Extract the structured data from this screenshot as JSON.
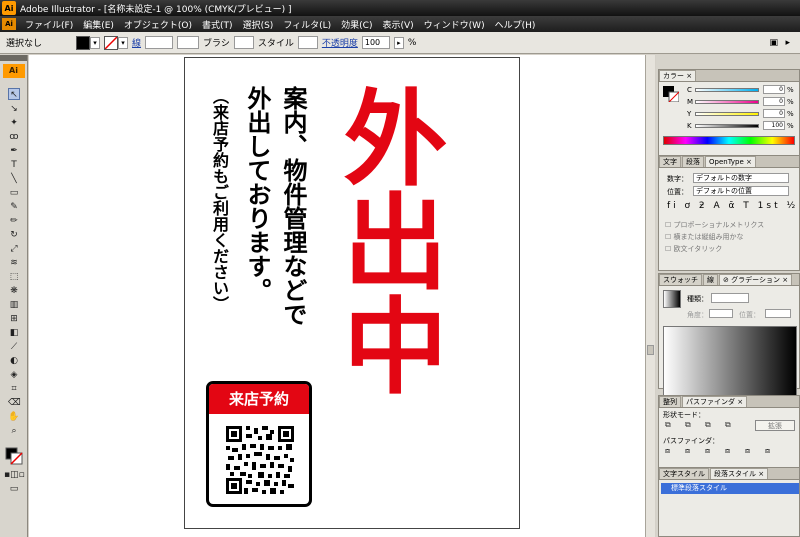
{
  "window": {
    "title": "Adobe Illustrator - [名称未設定-1 @ 100% (CMYK/プレビュー) ]",
    "app_abbrev": "Ai"
  },
  "menu": [
    "ファイル(F)",
    "編集(E)",
    "オブジェクト(O)",
    "書式(T)",
    "選択(S)",
    "フィルタ(L)",
    "効果(C)",
    "表示(V)",
    "ウィンドウ(W)",
    "ヘルプ(H)"
  ],
  "control": {
    "selection": "選択なし",
    "stroke_label": "線",
    "brush_label": "ブラシ",
    "style_label": "スタイル",
    "opacity_label": "不透明度",
    "opacity_value": "100",
    "percent": "%"
  },
  "artwork": {
    "headline": "外出中",
    "line1": "案内、物件管理などで",
    "line2": "外出しております。",
    "line3": "（来店予約もご利用ください）",
    "qr_title": "来店予約",
    "headline_color": "#e30613"
  },
  "color_panel": {
    "tab": "カラー",
    "channels": [
      {
        "label": "C",
        "value": "0"
      },
      {
        "label": "M",
        "value": "0"
      },
      {
        "label": "Y",
        "value": "0"
      },
      {
        "label": "K",
        "value": "100"
      }
    ],
    "percent": "%"
  },
  "char_panel": {
    "tabs": [
      "文字",
      "段落",
      "OpenType"
    ],
    "numeral_label": "数字：",
    "numeral_value": "デフォルトの数字",
    "position_label": "位置：",
    "position_value": "デフォルトの位置",
    "checkbox1": "プロポーショナルメトリクス",
    "checkbox2": "横または縦組み用かな",
    "checkbox3": "欧文イタリック"
  },
  "gradient_panel": {
    "tabs": [
      "スウォッチ",
      "線",
      "グラデーション"
    ],
    "type_label": "種類：",
    "angle_label": "角度：",
    "position_label": "位置："
  },
  "pathfinder_panel": {
    "tabs": [
      "整列",
      "パスファインダ"
    ],
    "shape_mode_label": "形状モード：",
    "pathfinder_label": "パスファインダ：",
    "expand_button": "拡張"
  },
  "style_panel": {
    "tabs": [
      "文字スタイル",
      "段落スタイル"
    ],
    "selected": "標準段落スタイル"
  }
}
